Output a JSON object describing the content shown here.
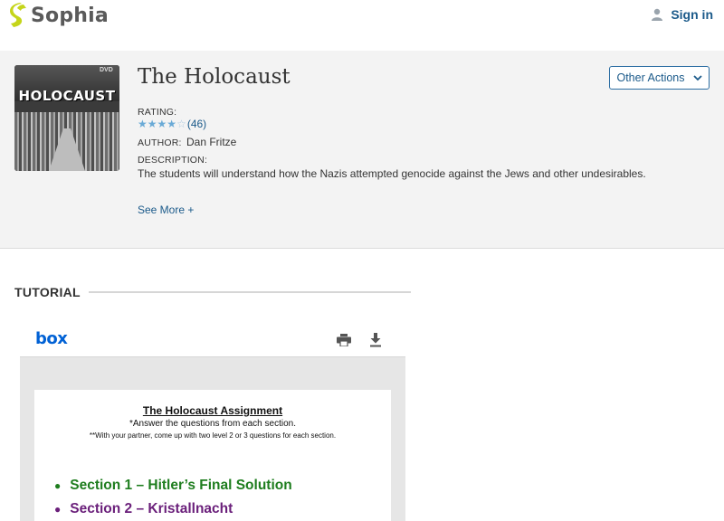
{
  "header": {
    "brand": "Sophia",
    "signin_label": "Sign in"
  },
  "course": {
    "thumbnail_text": "HOLOCAUST",
    "thumbnail_badge": "DVD",
    "title": "The Holocaust",
    "other_actions_label": "Other Actions",
    "rating_label": "RATING:",
    "rating_value": 4,
    "rating_max": 5,
    "rating_count": "(46)",
    "author_label": "AUTHOR:",
    "author_name": "Dan Fritze",
    "description_label": "DESCRIPTION:",
    "description": "The students will understand how the Nazis attempted genocide against the Jews and other undesirables.",
    "see_more_label": "See More +"
  },
  "tutorial": {
    "heading": "TUTORIAL"
  },
  "viewer": {
    "brand": "box",
    "icons": [
      "print-icon",
      "download-icon"
    ],
    "document": {
      "title": "The Holocaust Assignment",
      "instruction_1": "*Answer the questions from each section.",
      "instruction_2": "**With your partner, come up with two level 2 or 3 questions for each section.",
      "sections": [
        "Section 1 – Hitler’s Final Solution",
        "Section 2 – Kristallnacht"
      ]
    }
  },
  "colors": {
    "brand_green": "#c5d51a",
    "link_blue": "#1b5a8a",
    "star_blue": "#6aaad6",
    "box_blue": "#0061d5",
    "section_1": "#1e7d1e",
    "section_2": "#6a1f7a"
  }
}
